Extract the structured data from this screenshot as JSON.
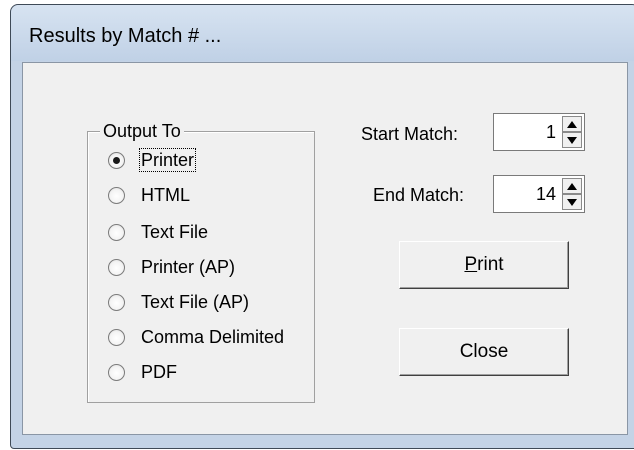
{
  "window": {
    "title": "Results by Match # ..."
  },
  "output_group": {
    "legend": "Output To",
    "options": [
      {
        "label": "Printer",
        "selected": true,
        "focused": true
      },
      {
        "label": "HTML",
        "selected": false
      },
      {
        "label": "Text File",
        "selected": false
      },
      {
        "label": "Printer (AP)",
        "selected": false
      },
      {
        "label": "Text File (AP)",
        "selected": false
      },
      {
        "label": "Comma Delimited",
        "selected": false
      },
      {
        "label": "PDF",
        "selected": false
      }
    ]
  },
  "start_match": {
    "label": "Start Match:",
    "value": "1"
  },
  "end_match": {
    "label": "End Match:",
    "value": "14"
  },
  "buttons": {
    "print": {
      "access_key": "P",
      "rest": "rint"
    },
    "close": {
      "label": "Close"
    }
  },
  "icons": {
    "spin_up": "up-triangle-icon",
    "spin_down": "down-triangle-icon"
  }
}
